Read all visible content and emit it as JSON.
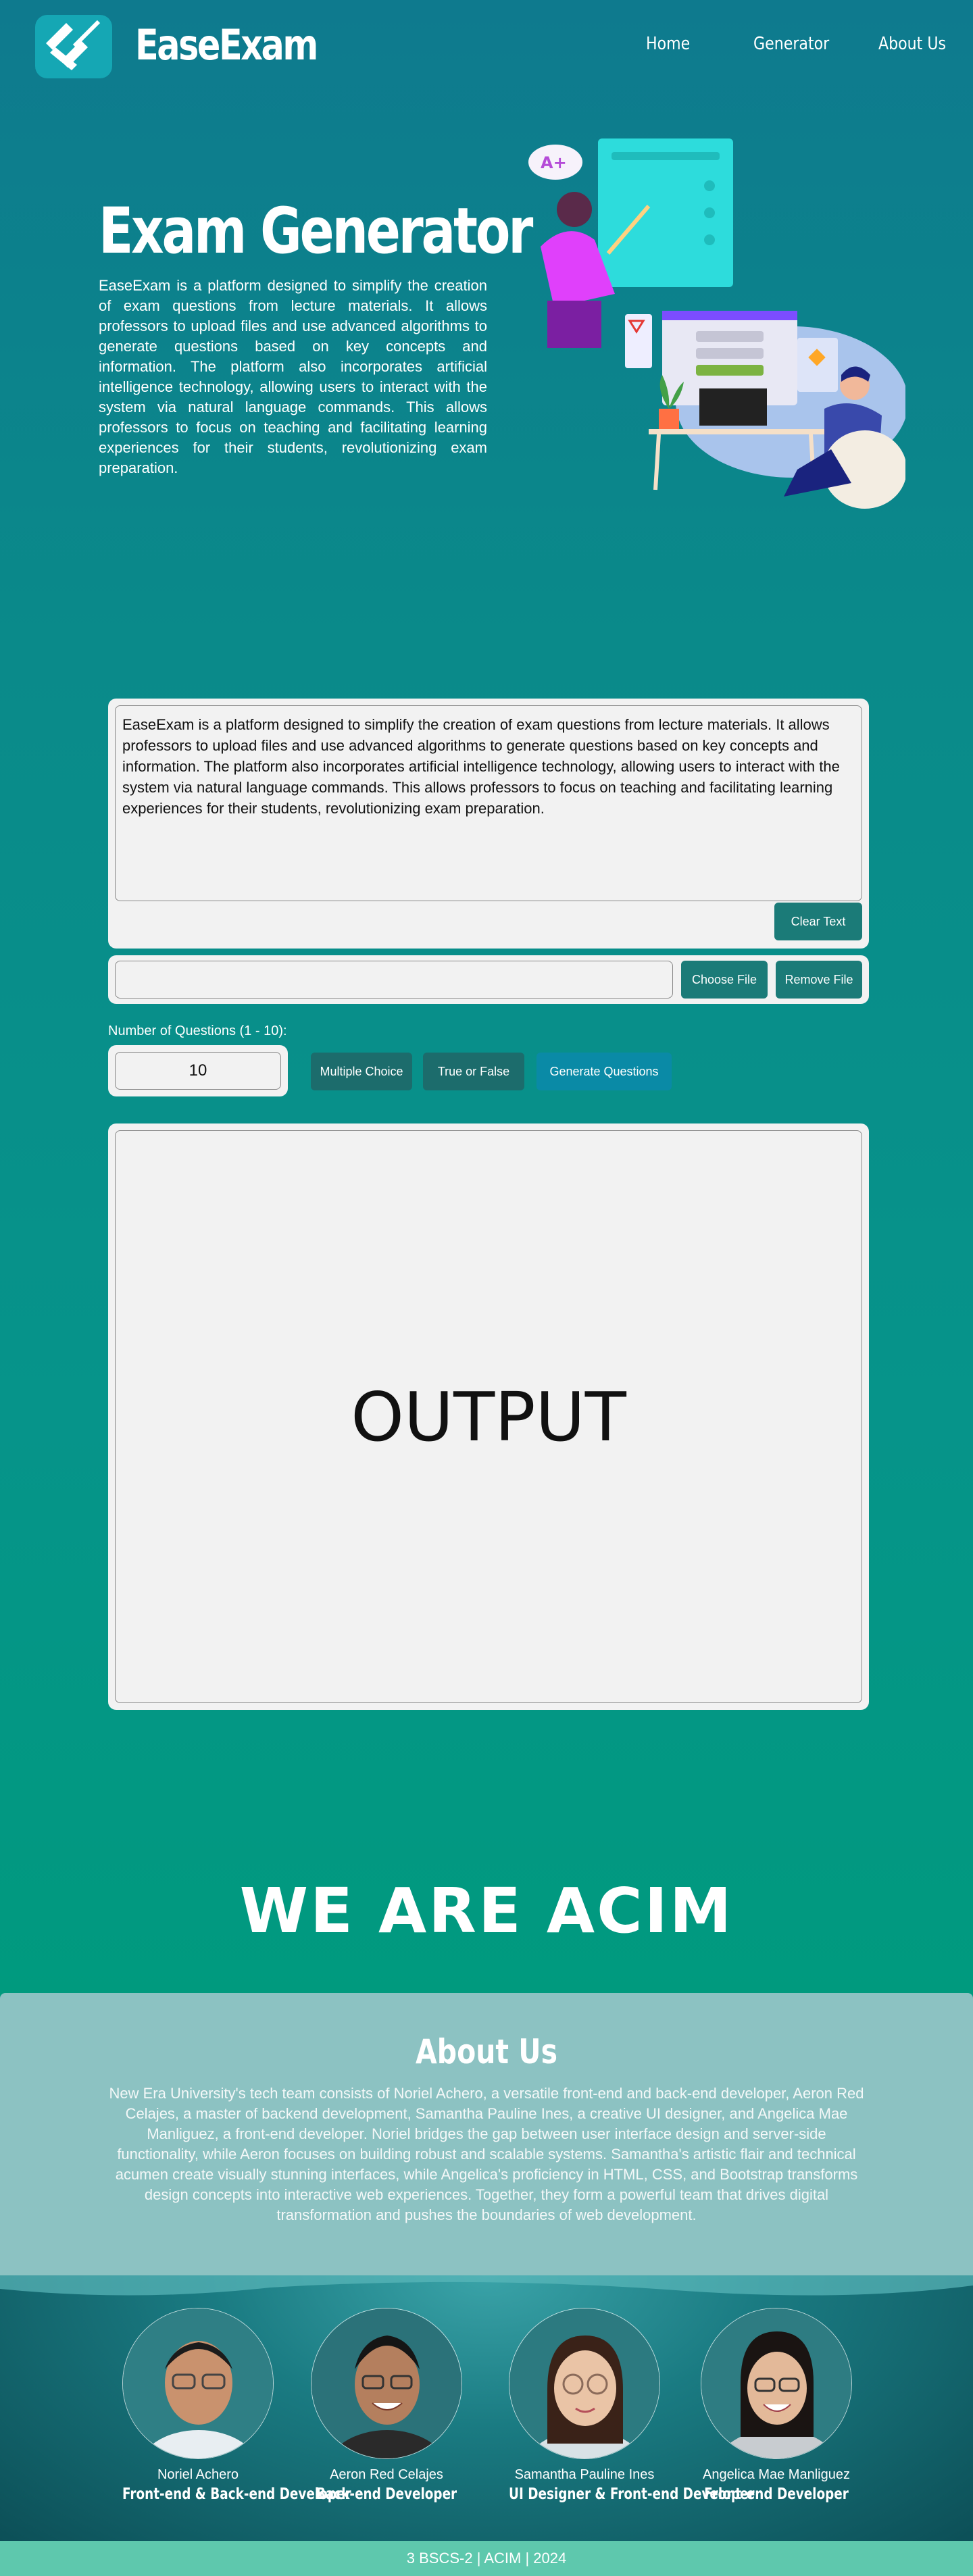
{
  "header": {
    "brand": "EaseExam",
    "nav": {
      "home": "Home",
      "generator": "Generator",
      "about": "About Us"
    }
  },
  "hero": {
    "title": "Exam Generator",
    "description": "EaseExam is a platform designed to simplify the creation of exam questions from lecture materials. It allows professors to upload files and use advanced algorithms to generate questions based on key concepts and information. The platform also incorporates artificial intelligence technology, allowing users to interact with the system via natural language commands. This allows professors to focus on teaching and facilitating learning experiences for their students, revolutionizing exam preparation.",
    "illustration_badge": "A+"
  },
  "generator": {
    "input_text": "EaseExam is a platform designed to simplify the creation of exam questions from lecture materials. It allows professors to upload files and use advanced algorithms to generate questions based on key concepts and information. The platform also incorporates artificial intelligence technology, allowing users to interact with the system via natural language commands. This allows professors to focus on teaching and facilitating learning experiences for their students, revolutionizing exam preparation.",
    "clear_label": "Clear Text",
    "choose_file_label": "Choose File",
    "remove_file_label": "Remove File",
    "num_questions_label": "Number of Questions (1 - 10):",
    "num_questions_value": "10",
    "multiple_choice_label": "Multiple Choice",
    "true_false_label": "True or False",
    "generate_label": "Generate Questions",
    "output_placeholder": "OUTPUT"
  },
  "team": {
    "heading": "WE ARE ACIM",
    "about_title": "About Us",
    "about_text": "New Era University's tech team consists of Noriel Achero, a versatile front-end and back-end developer, Aeron Red Celajes, a master of backend development, Samantha Pauline Ines, a creative UI designer, and Angelica Mae Manliguez, a front-end developer. Noriel bridges the gap between user interface design and server-side functionality, while Aeron focuses on building robust and scalable systems. Samantha's artistic flair and technical acumen create visually stunning interfaces, while Angelica's proficiency in HTML, CSS, and Bootstrap transforms design concepts into interactive web experiences. Together, they form a powerful team that drives digital transformation and pushes the boundaries of web development.",
    "members": [
      {
        "name": "Noriel Achero",
        "role": "Front-end & Back-end Developer"
      },
      {
        "name": "Aeron Red Celajes",
        "role": "Back-end Developer"
      },
      {
        "name": "Samantha Pauline Ines",
        "role": "UI Designer & Front-end Developer"
      },
      {
        "name": "Angelica Mae Manliguez",
        "role": "Front-end Developer"
      }
    ]
  },
  "footer": {
    "text": "3 BSCS-2 | ACIM | 2024"
  },
  "colors": {
    "teal_button": "#1b7b78",
    "generate_button": "#0a8aa6",
    "footer_bg": "#5ec8ad",
    "about_bg": "#8cc2c2"
  }
}
